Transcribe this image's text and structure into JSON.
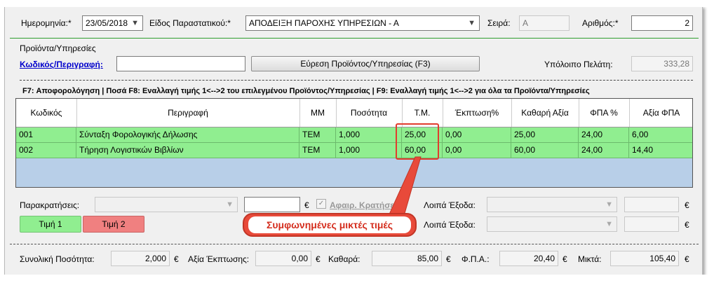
{
  "header": {
    "date_label": "Ημερομηνία:*",
    "date_value": "23/05/2018",
    "doctype_label": "Είδος Παραστατικού:*",
    "doctype_value": "ΑΠΟΔΕΙΞΗ ΠΑΡΟΧΗΣ ΥΠΗΡΕΣΙΩΝ - Α",
    "series_label": "Σειρά:",
    "series_value": "A",
    "number_label": "Αριθμός:*",
    "number_value": "2"
  },
  "products": {
    "group_label": "Προϊόντα/Υπηρεσίες",
    "code_link": "Κωδικός/Περιγραφή:",
    "code_value": "",
    "find_button": "Εύρεση Προϊόντος/Υπηρεσίας (F3)",
    "balance_label": "Υπόλοιπο Πελάτη:",
    "balance_value": "333,28"
  },
  "shortcuts": "F7: Αποφορολόγηση | Ποσά F8: Εναλλαγή τιμής 1<-->2 του επιλεγμένου Προϊόντος/Υπηρεσίας | F9: Εναλλαγή τιμής 1<-->2 για όλα τα Προϊόντα/Υπηρεσίες",
  "table": {
    "columns": [
      "Κωδικός",
      "Περιγραφή",
      "ΜΜ",
      "Ποσότητα",
      "Τ.Μ.",
      "Έκπτωση%",
      "Καθαρή Αξία",
      "ΦΠΑ %",
      "Αξία ΦΠΑ"
    ],
    "rows": [
      [
        "001",
        "Σύνταξη Φορολογικής Δήλωσης",
        "ΤΕΜ",
        "1,000",
        "25,00",
        "0,00",
        "25,00",
        "24,00",
        "6,00"
      ],
      [
        "002",
        "Τήρηση Λογιστικών Βιβλίων",
        "ΤΕΜ",
        "1,000",
        "60,00",
        "0,00",
        "60,00",
        "24,00",
        "14,40"
      ]
    ]
  },
  "withholding": {
    "label": "Παρακρατήσεις:",
    "euro": "€",
    "checkbox_label": "Αφαιρ. Κρατήσεων",
    "other_expenses_label": "Λοιπά Έξοδα:",
    "price1_button": "Τιμή 1",
    "price2_button": "Τιμή 2"
  },
  "callout": "Συμφωνημένες μικτές τιμές",
  "totals": {
    "qty_label": "Συνολική Ποσότητα:",
    "qty_value": "2,000",
    "discount_label": "Αξία Έκπτωσης:",
    "discount_value": "0,00",
    "net_label": "Καθαρά:",
    "net_value": "85,00",
    "vat_label": "Φ.Π.Α.:",
    "vat_value": "20,40",
    "gross_label": "Μικτά:",
    "gross_value": "105,40",
    "euro": "€"
  },
  "colors": {
    "row_green": "#90ee90",
    "grid_blue": "#b8cfe8",
    "price1": "#90ee90",
    "price2": "#f08080",
    "callout_red": "#e84a3a"
  }
}
